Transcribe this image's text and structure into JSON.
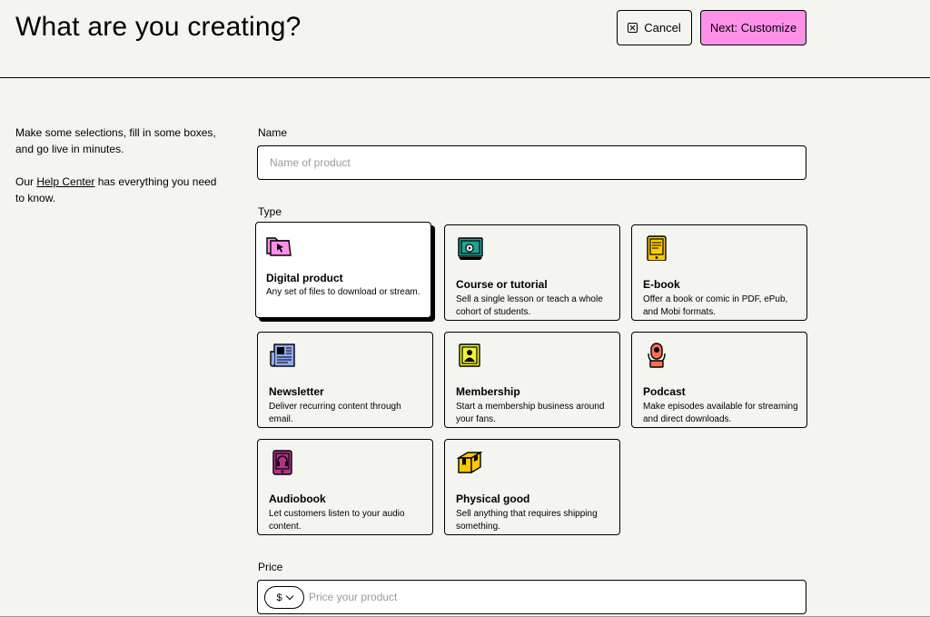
{
  "header": {
    "title": "What are you creating?",
    "cancel_label": "Cancel",
    "next_label": "Next: Customize"
  },
  "intro": {
    "line1": "Make some selections, fill in some boxes, and go live in minutes.",
    "line2_prefix": "Our ",
    "help_link": "Help Center",
    "line2_suffix": " has everything you need to know."
  },
  "name": {
    "label": "Name",
    "placeholder": "Name of product"
  },
  "type": {
    "label": "Type",
    "selected": "Digital product",
    "options": [
      {
        "title": "Digital product",
        "desc": "Any set of files to download or stream.",
        "icon": "folder-cursor-icon"
      },
      {
        "title": "Course or tutorial",
        "desc": "Sell a single lesson or teach a whole cohort of students.",
        "icon": "video-screen-icon"
      },
      {
        "title": "E-book",
        "desc": "Offer a book or comic in PDF, ePub, and Mobi formats.",
        "icon": "ebook-reader-icon"
      },
      {
        "title": "Newsletter",
        "desc": "Deliver recurring content through email.",
        "icon": "newspaper-icon"
      },
      {
        "title": "Membership",
        "desc": "Start a membership business around your fans.",
        "icon": "membership-card-icon"
      },
      {
        "title": "Podcast",
        "desc": "Make episodes available for streaming and direct downloads.",
        "icon": "microphone-icon"
      },
      {
        "title": "Audiobook",
        "desc": "Let customers listen to your audio content.",
        "icon": "headphones-book-icon"
      },
      {
        "title": "Physical good",
        "desc": "Sell anything that requires shipping something.",
        "icon": "package-box-icon"
      }
    ]
  },
  "price": {
    "label": "Price",
    "currency": "$",
    "placeholder": "Price your product"
  },
  "colors": {
    "accent": "#ff90e8",
    "background": "#f4f4f0"
  }
}
